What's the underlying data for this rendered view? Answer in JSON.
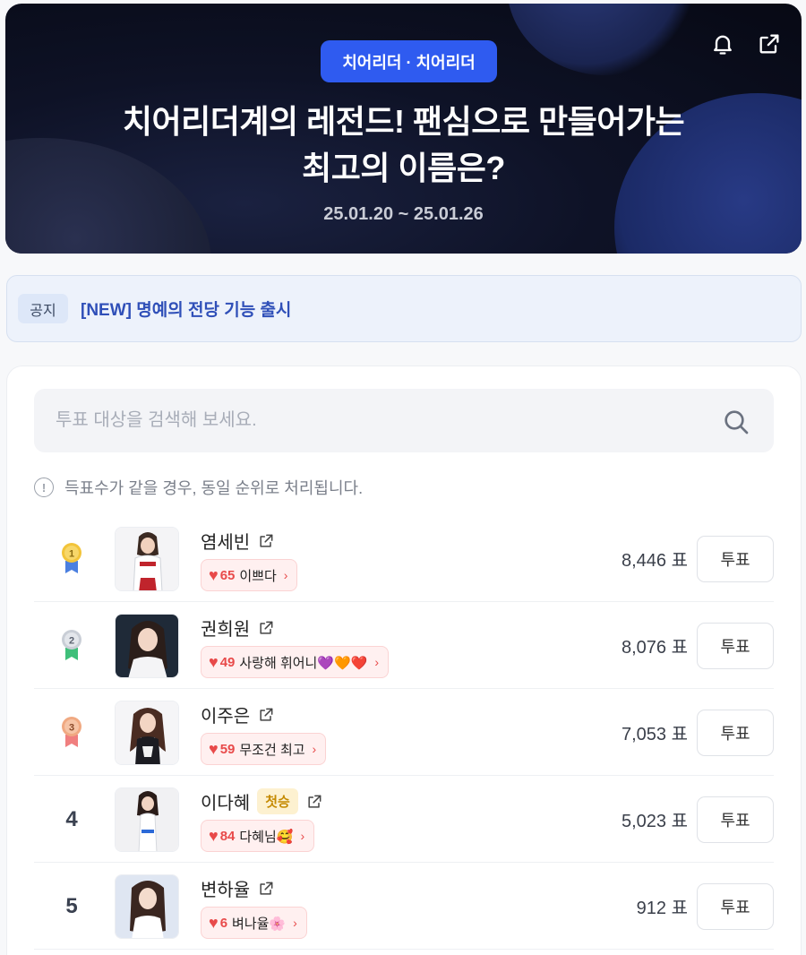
{
  "hero": {
    "category": "치어리더 · 치어리더",
    "title_line1": "치어리더계의 레전드! 팬심으로 만들어가는",
    "title_line2": "최고의 이름은?",
    "date_range": "25.01.20 ~ 25.01.26"
  },
  "notice": {
    "tag": "공지",
    "text": "[NEW] 명예의 전당 기능 출시"
  },
  "search": {
    "placeholder": "투표 대상을 검색해 보세요."
  },
  "info_text": "득표수가 같을 경우, 동일 순위로 처리됩니다.",
  "colors": {
    "accent": "#2f5bf0",
    "heart": "#e84a4a",
    "gold": "#f2c43a",
    "silver": "#c9ced6",
    "bronze": "#f0a982"
  },
  "candidates": [
    {
      "rank": "1",
      "medal": "gold",
      "name": "염세빈",
      "cheer_count": "65",
      "cheer_text": "이쁘다",
      "votes": "8,446 표",
      "vote_label": "투표"
    },
    {
      "rank": "2",
      "medal": "silver",
      "name": "권희원",
      "cheer_count": "49",
      "cheer_text": "사랑해 휘어니💜🧡❤️",
      "votes": "8,076 표",
      "vote_label": "투표"
    },
    {
      "rank": "3",
      "medal": "bronze",
      "name": "이주은",
      "cheer_count": "59",
      "cheer_text": "무조건 최고",
      "votes": "7,053 표",
      "vote_label": "투표"
    },
    {
      "rank": "4",
      "name": "이다혜",
      "badge": "첫승",
      "cheer_count": "84",
      "cheer_text": "다혜님🥰",
      "votes": "5,023 표",
      "vote_label": "투표"
    },
    {
      "rank": "5",
      "name": "변하율",
      "cheer_count": "6",
      "cheer_text": "벼나율🌸",
      "votes": "912 표",
      "vote_label": "투표"
    }
  ]
}
